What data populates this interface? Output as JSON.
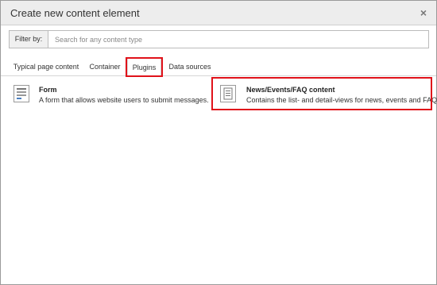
{
  "dialog": {
    "title": "Create new content element",
    "close_label": "×"
  },
  "filter": {
    "label": "Filter by:",
    "placeholder": "Search for any content type",
    "value": ""
  },
  "tabs": [
    {
      "label": "Typical page content",
      "active": false
    },
    {
      "label": "Container",
      "active": false
    },
    {
      "label": "Plugins",
      "active": true
    },
    {
      "label": "Data sources",
      "active": false
    }
  ],
  "items": [
    {
      "title": "Form",
      "description": "A form that allows website users to submit messages.",
      "icon": "form-icon"
    },
    {
      "title": "News/Events/FAQ content",
      "description": "Contains the list- and detail-views for news, events and FAQ",
      "icon": "document-icon"
    }
  ],
  "colors": {
    "highlight": "#e0121a",
    "header_bg": "#ededed",
    "form_icon_accent": "#4a7fc0"
  }
}
